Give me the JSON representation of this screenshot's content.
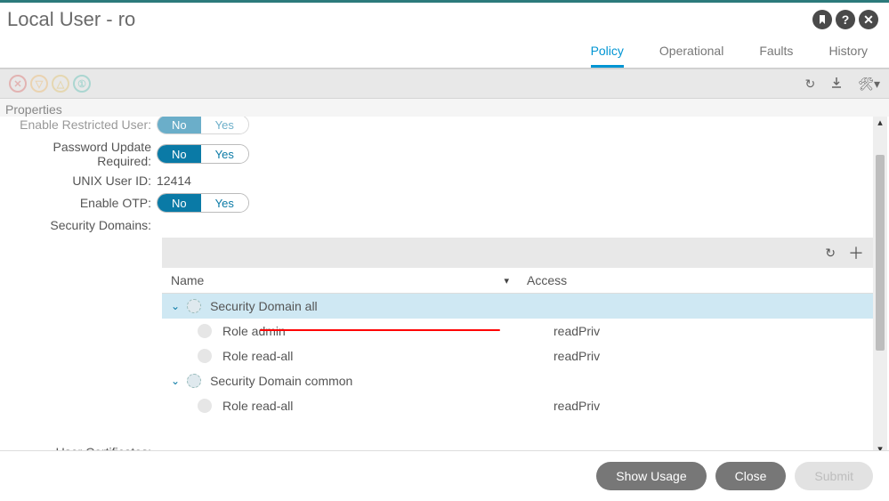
{
  "header": {
    "title": "Local User - ro"
  },
  "tabs": {
    "policy": "Policy",
    "operational": "Operational",
    "faults": "Faults",
    "history": "History"
  },
  "properties_label": "Properties",
  "fields": {
    "restricted_label": "Enable Restricted User:",
    "restricted_no": "No",
    "restricted_yes": "Yes",
    "pwd_update_label": "Password Update Required:",
    "pwd_no": "No",
    "pwd_yes": "Yes",
    "unix_uid_label": "UNIX User ID:",
    "unix_uid_value": "12414",
    "otp_label": "Enable OTP:",
    "otp_no": "No",
    "otp_yes": "Yes",
    "sec_domains_label": "Security Domains:",
    "user_cert_label": "User Certificates:"
  },
  "sec_table": {
    "col_name": "Name",
    "col_access": "Access",
    "rows": {
      "g1": "Security Domain all",
      "r1_name": "Role admin",
      "r1_access": "readPriv",
      "r2_name": "Role read-all",
      "r2_access": "readPriv",
      "g2": "Security Domain common",
      "r3_name": "Role read-all",
      "r3_access": "readPriv"
    }
  },
  "footer": {
    "show_usage": "Show Usage",
    "close": "Close",
    "submit": "Submit"
  }
}
